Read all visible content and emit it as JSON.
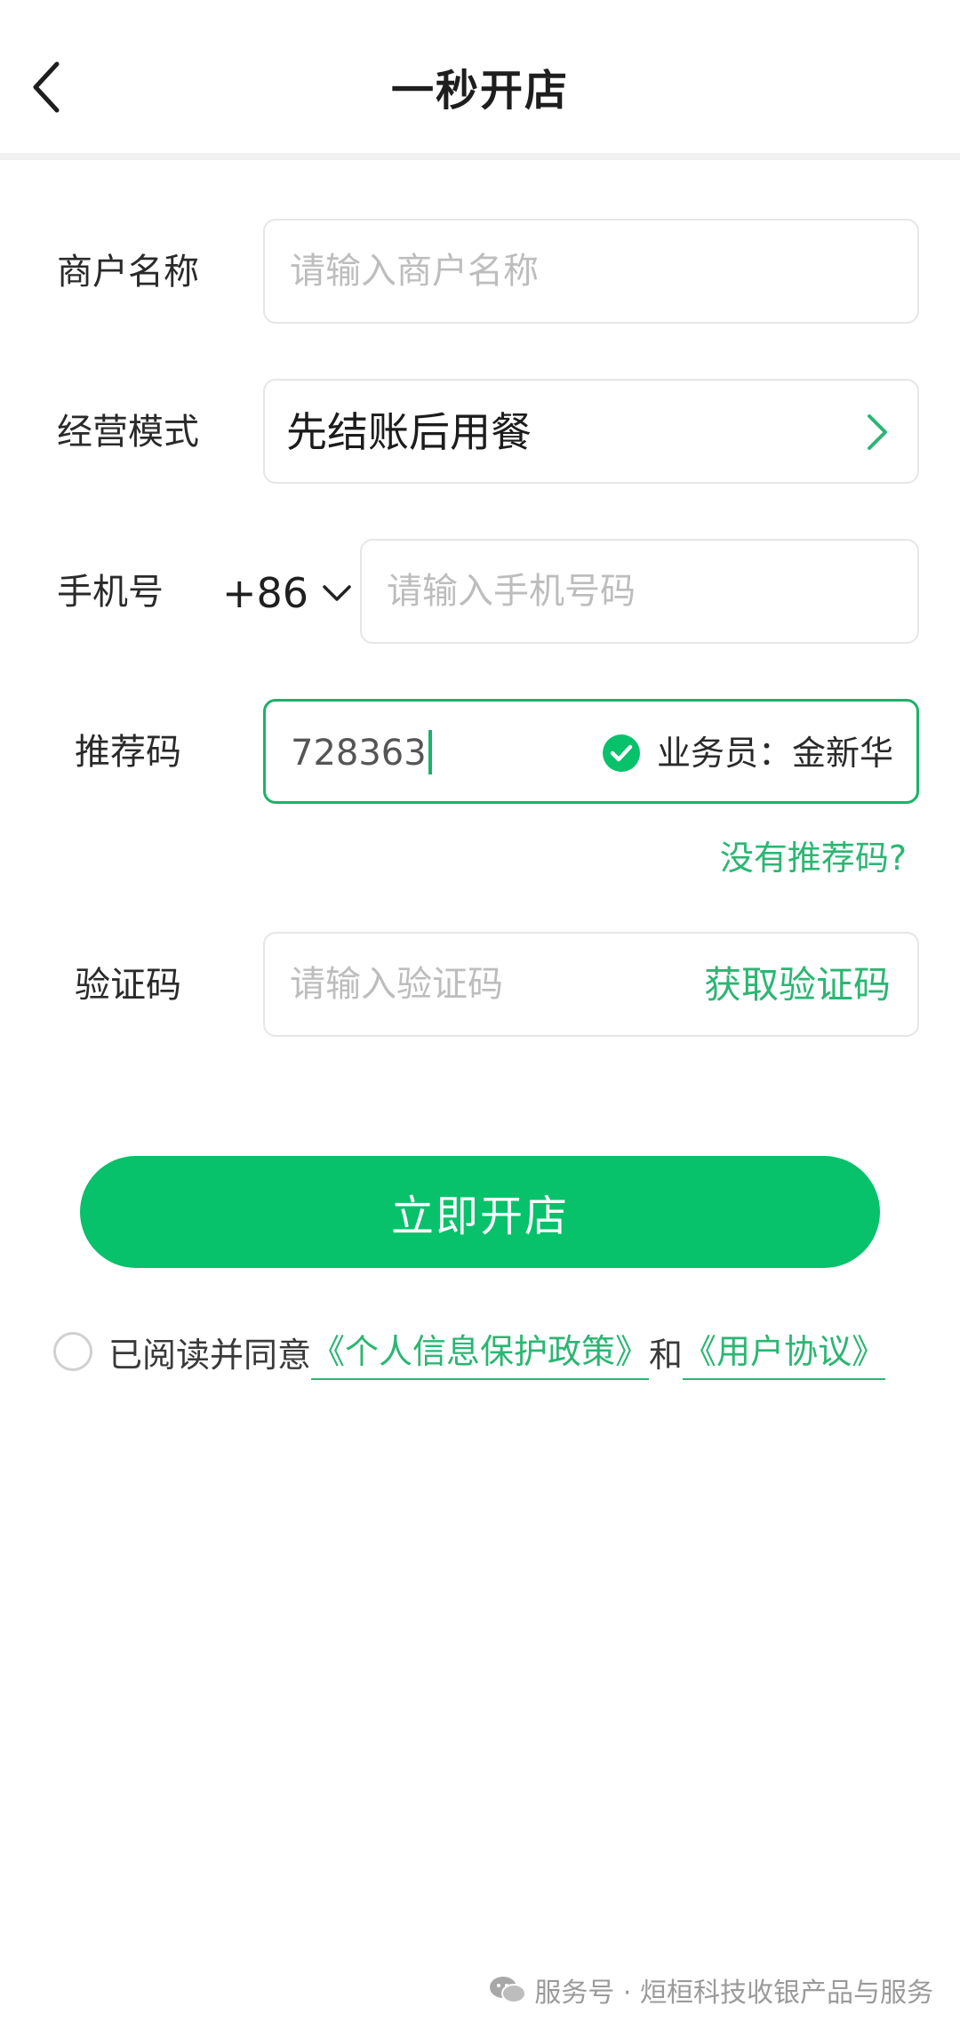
{
  "header": {
    "title": "一秒开店"
  },
  "form": {
    "merchant_name": {
      "label": "商户名称",
      "placeholder": "请输入商户名称",
      "value": ""
    },
    "business_mode": {
      "label": "经营模式",
      "value": "先结账后用餐"
    },
    "phone": {
      "label": "手机号",
      "country_code": "+86",
      "placeholder": "请输入手机号码",
      "value": ""
    },
    "referral": {
      "label": "推荐码",
      "value": "728363",
      "verified_text": "业务员：金新华",
      "no_code_link": "没有推荐码?"
    },
    "verification": {
      "label": "验证码",
      "placeholder": "请输入验证码",
      "value": "",
      "get_code": "获取验证码"
    }
  },
  "submit_label": "立即开店",
  "agreement": {
    "prefix": "已阅读并同意",
    "privacy_link": "《个人信息保护政策》",
    "and": "和",
    "user_link": "《用户协议》",
    "checked": false
  },
  "watermark": {
    "text": "服务号 · 烜桓科技收银产品与服务"
  },
  "colors": {
    "accent": "#07c16b",
    "link": "#2bb673",
    "border": "#e6e6e6"
  },
  "icons": {
    "back": "chevron-left-icon",
    "mode_arrow": "chevron-right-icon",
    "country_dropdown": "chevron-down-icon",
    "verified": "check-circle-icon",
    "watermark": "wechat-icon"
  }
}
